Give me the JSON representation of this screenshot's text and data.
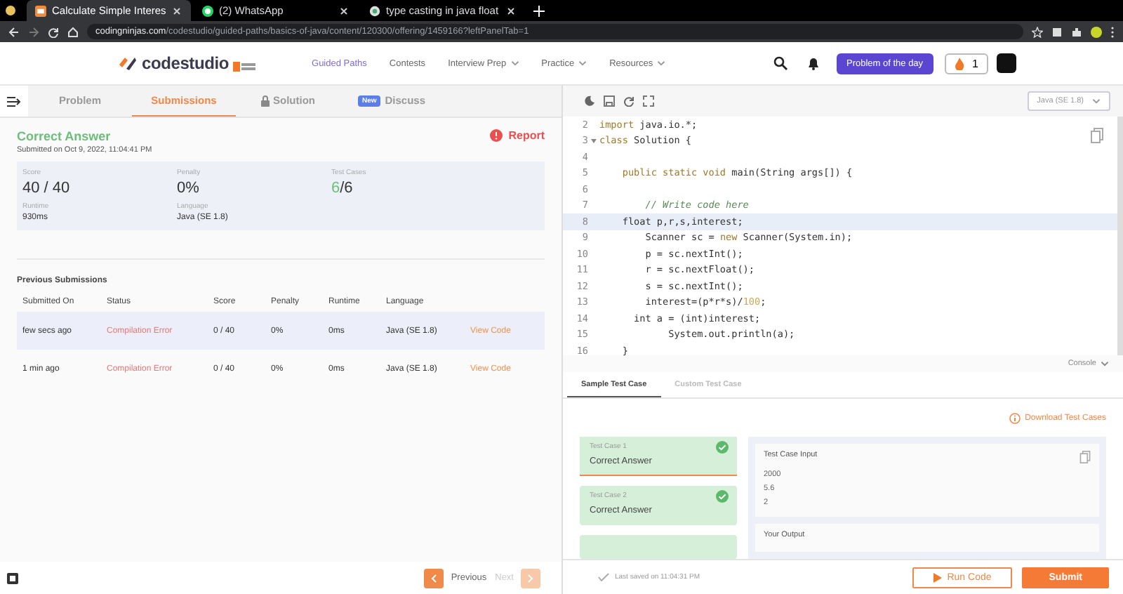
{
  "browser": {
    "tabs": [
      {
        "title": "Calculate Simple Interes",
        "selected": true
      },
      {
        "title": "(2) WhatsApp",
        "selected": false
      },
      {
        "title": "type casting in java float",
        "selected": false
      }
    ],
    "url_host": "codingninjas.com",
    "url_path": "/codestudio/guided-paths/basics-of-java/content/120300/offering/1459166?leftPanelTab=1"
  },
  "header": {
    "logo": "codestudio",
    "nav": [
      {
        "label": "Guided Paths",
        "selected": true,
        "dropdown": false
      },
      {
        "label": "Contests",
        "selected": false,
        "dropdown": false
      },
      {
        "label": "Interview Prep",
        "selected": false,
        "dropdown": true
      },
      {
        "label": "Practice",
        "selected": false,
        "dropdown": true
      },
      {
        "label": "Resources",
        "selected": false,
        "dropdown": true
      }
    ],
    "problem_of_day": "Problem of the day",
    "streak": "1"
  },
  "left_tabs": [
    {
      "label": "Problem",
      "kind": "plain",
      "selected": false
    },
    {
      "label": "Submissions",
      "kind": "plain",
      "selected": true
    },
    {
      "label": "Solution",
      "kind": "locked",
      "selected": false
    },
    {
      "label": "Discuss",
      "kind": "new",
      "badge": "New",
      "selected": false
    }
  ],
  "result": {
    "status": "Correct Answer",
    "submitted": "Submitted on Oct 9, 2022, 11:04:41 PM",
    "report": "Report",
    "stats": [
      {
        "label": "Score",
        "value": "40 / 40"
      },
      {
        "label": "Penalty",
        "value": "0%"
      },
      {
        "label": "Test Cases",
        "passed": "6",
        "total": "/6"
      }
    ],
    "details": [
      {
        "label": "Runtime",
        "value": "930ms"
      },
      {
        "label": "Language",
        "value": "Java (SE 1.8)"
      }
    ]
  },
  "previous": {
    "title": "Previous Submissions",
    "columns": [
      "Submitted On",
      "Status",
      "Score",
      "Penalty",
      "Runtime",
      "Language"
    ],
    "rows": [
      {
        "selected": true,
        "cells": [
          "few secs ago",
          "Compilation Error",
          "0 / 40",
          "0%",
          "0ms",
          "Java (SE 1.8)"
        ],
        "link": "View Code"
      },
      {
        "selected": false,
        "cells": [
          "1 min ago",
          "Compilation Error",
          "0 / 40",
          "0%",
          "0ms",
          "Java (SE 1.8)"
        ],
        "link": "View Code"
      }
    ]
  },
  "pager": [
    {
      "label": "Previous",
      "kind": "prev",
      "disabled": false
    },
    {
      "label": "Next",
      "kind": "next",
      "disabled": true
    }
  ],
  "editor": {
    "language": "Java (SE 1.8)",
    "lines": [
      {
        "number": "2",
        "foldable": false,
        "current": false,
        "tokens": [
          {
            "t": "import",
            "kind": "keyword"
          },
          {
            "t": " java.io.*;",
            "kind": "plain"
          }
        ]
      },
      {
        "number": "3",
        "foldable": true,
        "current": false,
        "tokens": [
          {
            "t": "class",
            "kind": "keyword"
          },
          {
            "t": " Solution {",
            "kind": "plain"
          }
        ]
      },
      {
        "number": "4",
        "foldable": false,
        "current": false
      },
      {
        "number": "5",
        "foldable": false,
        "current": false,
        "tokens": [
          {
            "t": "    public static void",
            "kind": "keyword"
          },
          {
            "t": " main(String args[]) {",
            "kind": "plain"
          }
        ]
      },
      {
        "number": "6",
        "foldable": false,
        "current": false
      },
      {
        "number": "7",
        "foldable": false,
        "current": false,
        "tokens": [
          {
            "t": "        // Write code here",
            "kind": "comment"
          }
        ]
      },
      {
        "number": "8",
        "foldable": false,
        "current": true,
        "tokens": [
          {
            "t": "    float p,r,s,interest;",
            "kind": "plain"
          }
        ]
      },
      {
        "number": "9",
        "foldable": false,
        "current": false,
        "tokens": [
          {
            "t": "        Scanner sc = ",
            "kind": "plain"
          },
          {
            "t": "new",
            "kind": "keyword"
          },
          {
            "t": " Scanner(System.in);",
            "kind": "plain"
          }
        ]
      },
      {
        "number": "10",
        "foldable": false,
        "current": false,
        "tokens": [
          {
            "t": "        p = sc.nextInt();",
            "kind": "plain"
          }
        ]
      },
      {
        "number": "11",
        "foldable": false,
        "current": false,
        "tokens": [
          {
            "t": "        r = sc.nextFloat();",
            "kind": "plain"
          }
        ]
      },
      {
        "number": "12",
        "foldable": false,
        "current": false,
        "tokens": [
          {
            "t": "        s = sc.nextInt();",
            "kind": "plain"
          }
        ]
      },
      {
        "number": "13",
        "foldable": false,
        "current": false,
        "tokens": [
          {
            "t": "        interest=(p*r*s)/",
            "kind": "plain"
          },
          {
            "t": "100",
            "kind": "number"
          },
          {
            "t": ";",
            "kind": "plain"
          }
        ]
      },
      {
        "number": "14",
        "foldable": false,
        "current": false,
        "tokens": [
          {
            "t": "      int a = (int)interest;",
            "kind": "plain"
          }
        ]
      },
      {
        "number": "15",
        "foldable": false,
        "current": false,
        "tokens": [
          {
            "t": "            System.out.println(a);",
            "kind": "plain"
          }
        ]
      },
      {
        "number": "16",
        "foldable": false,
        "current": false,
        "tokens": [
          {
            "t": "    }",
            "kind": "plain"
          }
        ]
      }
    ],
    "console": "Console"
  },
  "test_tabs": [
    {
      "label": "Sample Test Case",
      "selected": true
    },
    {
      "label": "Custom Test Case",
      "selected": false
    }
  ],
  "download": "Download Test Cases",
  "test_cases": [
    {
      "title": "Test Case 1",
      "result": "Correct Answer",
      "selected": true
    },
    {
      "title": "Test Case 2",
      "result": "Correct Answer",
      "selected": false
    }
  ],
  "input": {
    "title": "Test Case Input",
    "lines": [
      "2000",
      "5.6",
      "2"
    ],
    "output_title": "Your Output"
  },
  "footer": {
    "saved": "Last saved on 11:04:31 PM",
    "run": "Run Code",
    "submit": "Submit"
  }
}
